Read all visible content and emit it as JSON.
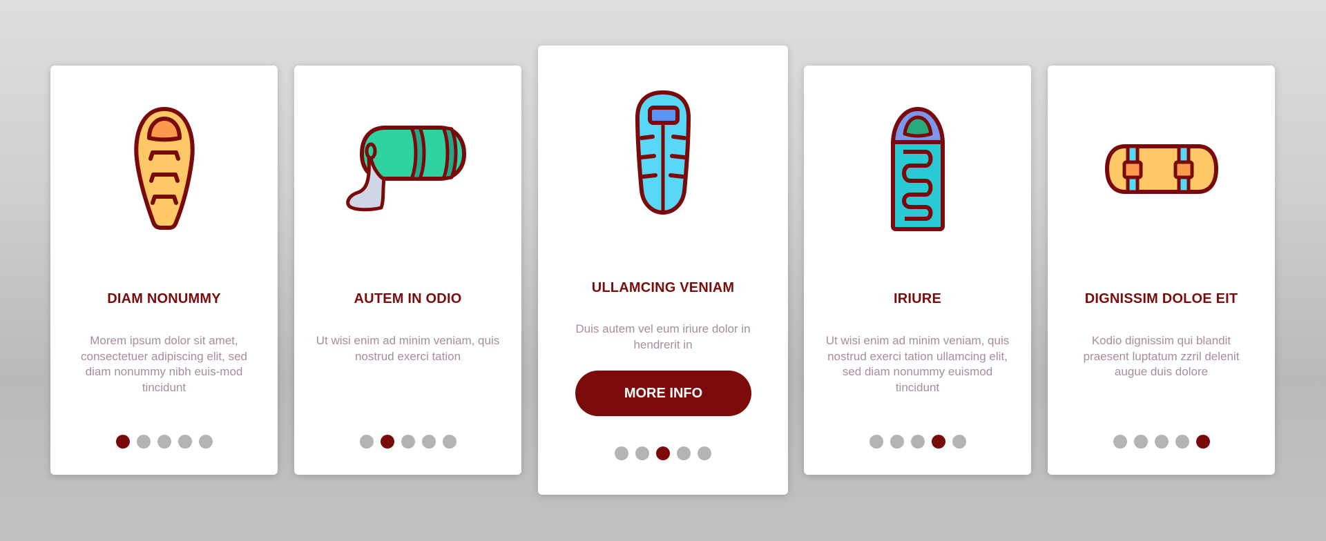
{
  "colors": {
    "accent": "#7a0c0c",
    "title": "#7a0c0c",
    "description": "#a88ba0",
    "dot_inactive": "#b3b3b3",
    "dot_active": "#7a0a0a",
    "icon_outline": "#7a0a0a"
  },
  "cards": [
    {
      "icon": "mummy-sleeping-bag-icon",
      "title": "DIAM NONUMMY",
      "description": "Morem ipsum dolor sit amet, consectetuer adipiscing elit, sed diam nonummy nibh euis-mod tincidunt",
      "page_count": 5,
      "active_page": 1
    },
    {
      "icon": "rolled-sleeping-bag-icon",
      "title": "AUTEM IN ODIO",
      "description": "Ut wisi enim ad minim veniam, quis nostrud exerci tation",
      "page_count": 5,
      "active_page": 2
    },
    {
      "icon": "zipper-sleeping-bag-icon",
      "title": "ULLAMCING VENIAM",
      "description": "Duis autem vel eum iriure dolor in hendrerit in",
      "button_label": "MORE INFO",
      "page_count": 5,
      "active_page": 3
    },
    {
      "icon": "hooded-sleeping-bag-icon",
      "title": "IRIURE",
      "description": "Ut wisi enim ad minim veniam, quis nostrud exerci tation ullamcing elit, sed diam nonummy euismod tincidunt",
      "page_count": 5,
      "active_page": 4
    },
    {
      "icon": "strapped-sleeping-mat-icon",
      "title": "DIGNISSIM DOLOE EIT",
      "description": "Kodio dignissim qui blandit praesent luptatum zzril delenit augue duis dolore",
      "page_count": 5,
      "active_page": 5
    }
  ]
}
